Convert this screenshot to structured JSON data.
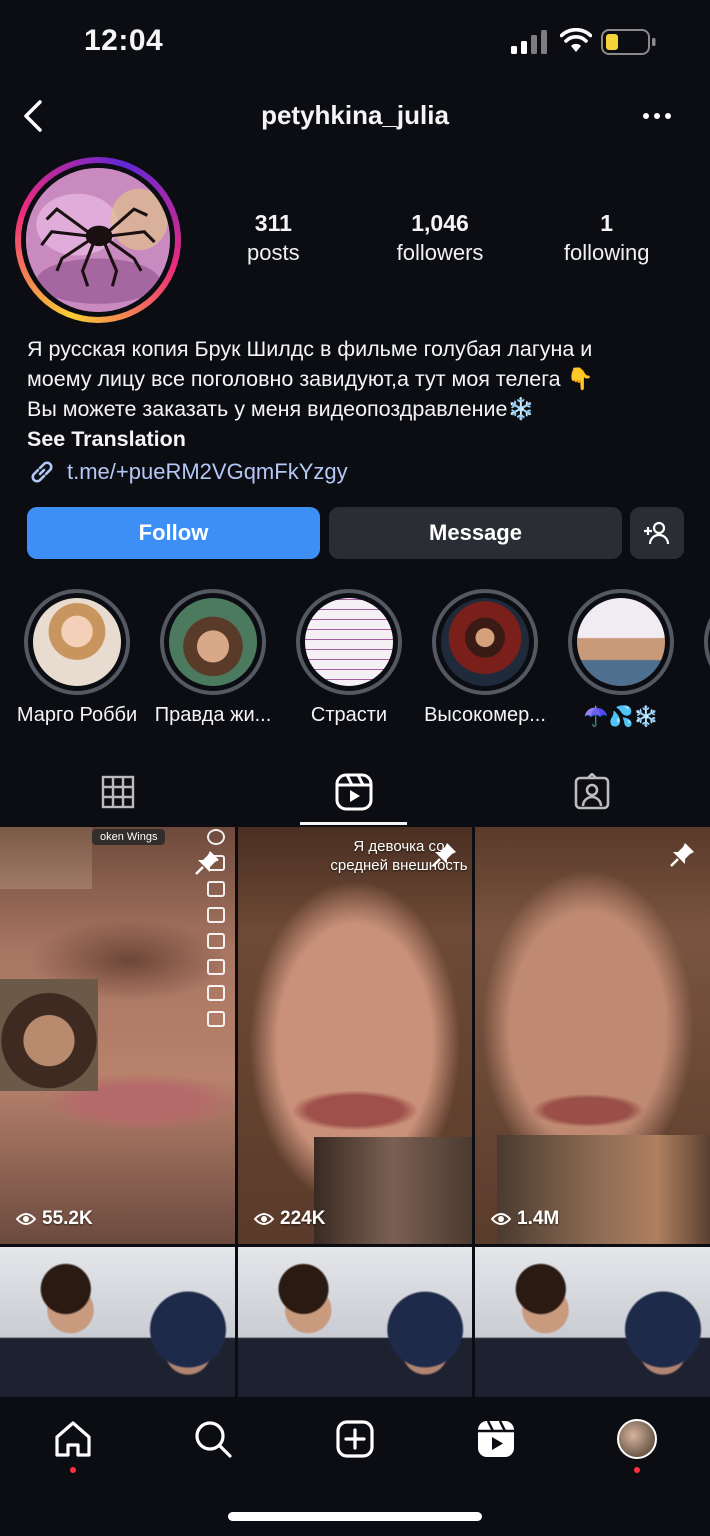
{
  "status_bar": {
    "time": "12:04"
  },
  "header": {
    "username": "petyhkina_julia"
  },
  "profile": {
    "stats": [
      {
        "num": "311",
        "label": "posts"
      },
      {
        "num": "1,046",
        "label": "followers"
      },
      {
        "num": "1",
        "label": "following"
      }
    ],
    "bio_lines": [
      "Я русская копия Брук Шилдс в фильме голубая лагуна и",
      "моему лицу все поголовно завидуют,а тут моя телега 👇",
      "Вы можете заказать у меня видеопоздравление❄️"
    ],
    "see_translation": "See Translation",
    "link": "t.me/+pueRM2VGqmFkYzgy"
  },
  "actions": {
    "follow": "Follow",
    "message": "Message"
  },
  "highlights": [
    {
      "label": "Марго Робби"
    },
    {
      "label": "Правда жи..."
    },
    {
      "label": "Страсти"
    },
    {
      "label": "Высокомер..."
    },
    {
      "label": "☂️💦❄️"
    }
  ],
  "grid": {
    "tiles": [
      {
        "views": "55.2K",
        "overlay": "oken Wings"
      },
      {
        "views": "224K",
        "overlay": "Я девочка со\nсредней внешность"
      },
      {
        "views": "1.4M",
        "overlay": ""
      }
    ]
  },
  "colors": {
    "accent": "#3d8ff6",
    "link": "#b4c8f5",
    "background": "#0b0d12",
    "notification": "#ff3040"
  }
}
